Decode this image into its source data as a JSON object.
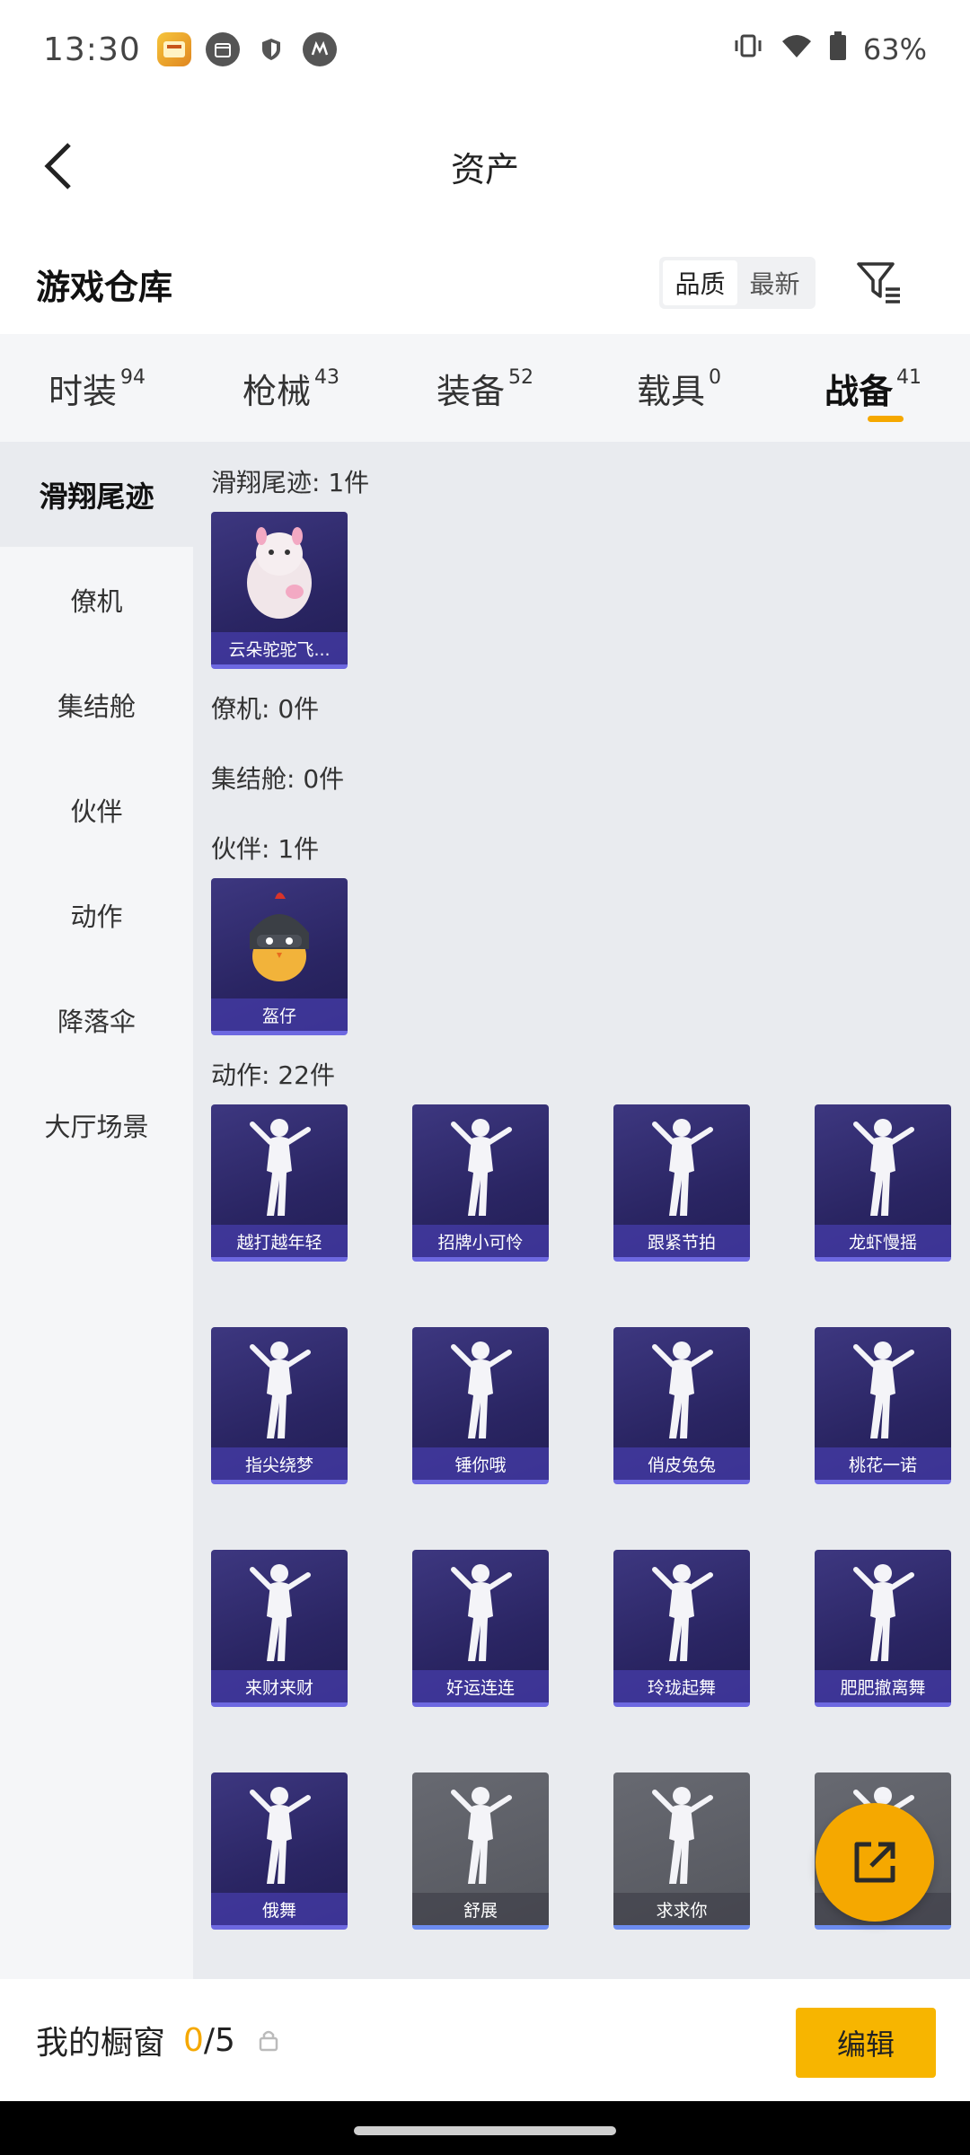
{
  "status": {
    "time": "13:30",
    "battery": "63%"
  },
  "header": {
    "title": "资产"
  },
  "warehouse": {
    "title": "游戏仓库",
    "sort_options": [
      "品质",
      "最新"
    ],
    "active_sort": "品质"
  },
  "tabs": [
    {
      "label": "时装",
      "count": "94"
    },
    {
      "label": "枪械",
      "count": "43"
    },
    {
      "label": "装备",
      "count": "52"
    },
    {
      "label": "载具",
      "count": "0"
    },
    {
      "label": "战备",
      "count": "41",
      "active": true
    }
  ],
  "side_nav": [
    {
      "label": "滑翔尾迹",
      "active": true
    },
    {
      "label": "僚机"
    },
    {
      "label": "集结舱"
    },
    {
      "label": "伙伴"
    },
    {
      "label": "动作"
    },
    {
      "label": "降落伞"
    },
    {
      "label": "大厅场景"
    }
  ],
  "sections": {
    "glide": {
      "title": "滑翔尾迹: 1件",
      "items": [
        "云朵驼驼飞..."
      ]
    },
    "wingman": {
      "title": "僚机: 0件"
    },
    "capsule": {
      "title": "集结舱: 0件"
    },
    "partner": {
      "title": "伙伴: 1件",
      "items": [
        "盔仔"
      ]
    },
    "emote": {
      "title": "动作: 22件",
      "items": [
        "越打越年轻",
        "招牌小可怜",
        "跟紧节拍",
        "龙虾慢摇",
        "指尖绕梦",
        "锤你哦",
        "俏皮兔兔",
        "桃花一诺",
        "来财来财",
        "好运连连",
        "玲珑起舞",
        "肥肥撤离舞",
        "俄舞",
        "舒展",
        "求求你",
        ""
      ]
    }
  },
  "bottom_bar": {
    "label": "我的橱窗",
    "current": "0",
    "separator_total": "/5",
    "edit_label": "编辑"
  },
  "colors": {
    "accent": "#f5a800",
    "card_bg": "#2a2563",
    "card_border": "#6d68e0"
  }
}
